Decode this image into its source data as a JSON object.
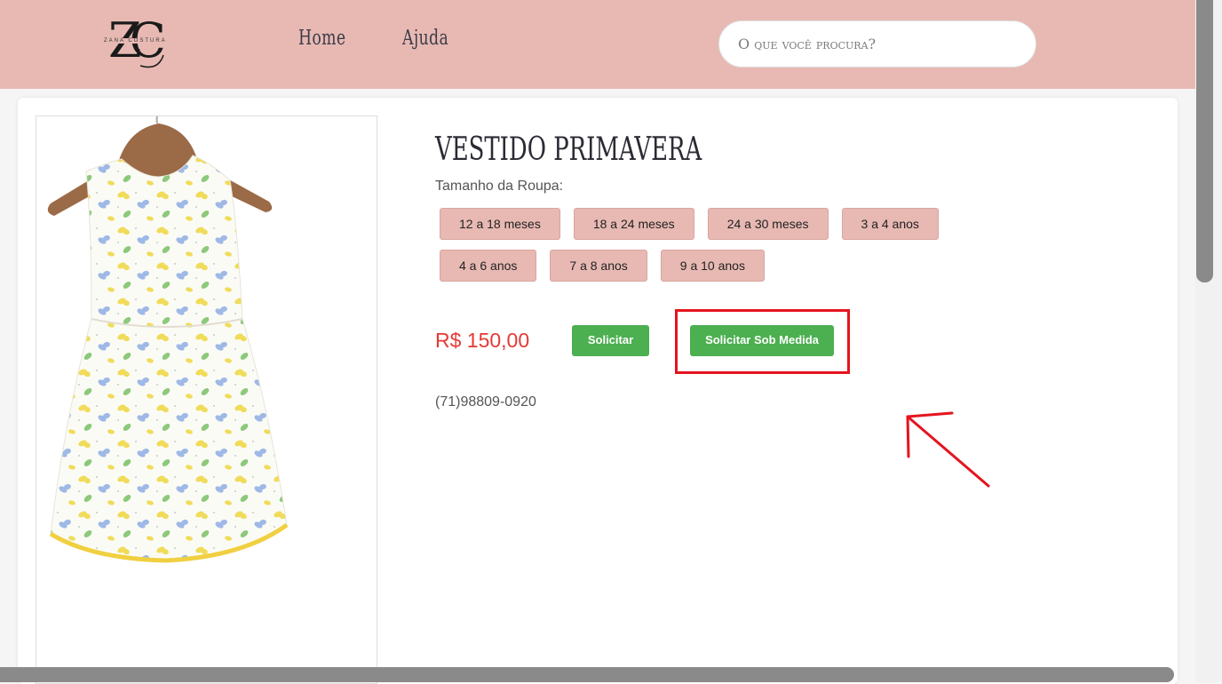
{
  "header": {
    "logo_initials": "ZC",
    "logo_tagline": "ZANA COSTURA",
    "nav": {
      "home": "Home",
      "help": "Ajuda"
    },
    "search_placeholder": "O que você procura?"
  },
  "product": {
    "title": "VESTIDO PRIMAVERA",
    "size_label": "Tamanho da Roupa:",
    "sizes": [
      "12 a 18 meses",
      "18 a 24 meses",
      "24 a 30 meses",
      "3 a 4 anos",
      "4 a 6 anos",
      "7 a 8 anos",
      "9 a 10 anos"
    ],
    "price": "R$ 150,00",
    "request_label": "Solicitar",
    "request_custom_label": "Solicitar Sob Medida",
    "phone": "(71)98809-0920"
  },
  "colors": {
    "header_bg": "#e8b9b3",
    "price": "#e53935",
    "button_green": "#4caf50",
    "annotation_red": "#e5141e"
  }
}
